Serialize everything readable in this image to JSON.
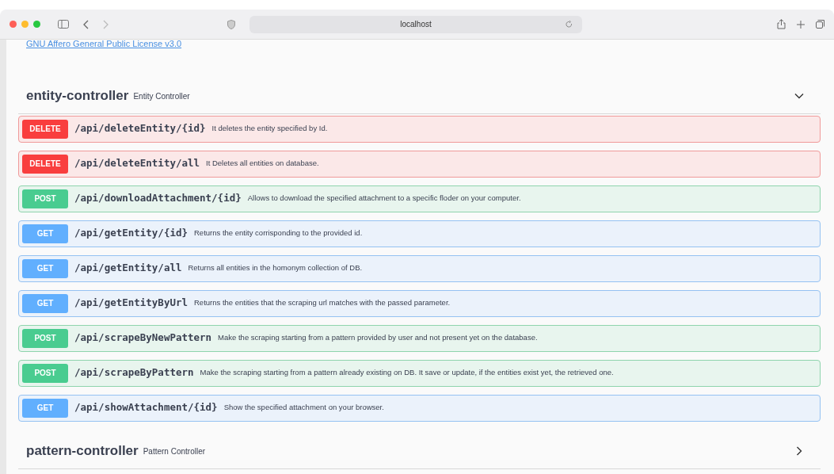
{
  "browser": {
    "address": "localhost"
  },
  "license_link": "GNU Affero General Public License v3.0",
  "controllers": [
    {
      "name": "entity-controller",
      "description": "Entity Controller",
      "expanded": true,
      "operations": [
        {
          "method": "DELETE",
          "kind": "delete",
          "path": "/api/deleteEntity/{id}",
          "summary": "It deletes the entity specified by Id."
        },
        {
          "method": "DELETE",
          "kind": "delete",
          "path": "/api/deleteEntity/all",
          "summary": "It Deletes all entities on database."
        },
        {
          "method": "POST",
          "kind": "post",
          "path": "/api/downloadAttachment/{id}",
          "summary": "Allows to download the specified attachment to a specific floder on your computer."
        },
        {
          "method": "GET",
          "kind": "get",
          "path": "/api/getEntity/{id}",
          "summary": "Returns the entity corrisponding to the provided id."
        },
        {
          "method": "GET",
          "kind": "get",
          "path": "/api/getEntity/all",
          "summary": "Returns all entities in the homonym collection of DB."
        },
        {
          "method": "GET",
          "kind": "get",
          "path": "/api/getEntityByUrl",
          "summary": "Returns the entities that the scraping url matches with the passed parameter."
        },
        {
          "method": "POST",
          "kind": "post",
          "path": "/api/scrapeByNewPattern",
          "summary": "Make the scraping starting from a pattern provided by user and not present yet on the database."
        },
        {
          "method": "POST",
          "kind": "post",
          "path": "/api/scrapeByPattern",
          "summary": "Make the scraping starting from a pattern already existing on DB. It save or update, if the entities exist yet, the retrieved one."
        },
        {
          "method": "GET",
          "kind": "get",
          "path": "/api/showAttachment/{id}",
          "summary": "Show the specified attachment on your browser."
        }
      ]
    },
    {
      "name": "pattern-controller",
      "description": "Pattern Controller",
      "expanded": false
    }
  ]
}
